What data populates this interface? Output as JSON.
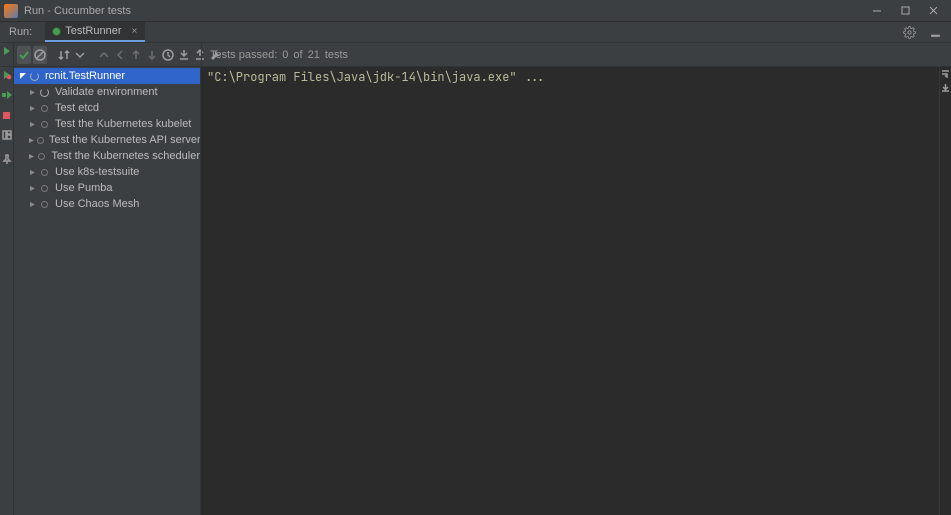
{
  "window": {
    "title": "Run - Cucumber tests"
  },
  "run_tab": {
    "label": "Run:",
    "active_tab": "TestRunner"
  },
  "status": {
    "prefix": "Tests passed:",
    "passed": "0",
    "separator": "of",
    "total": "21",
    "suffix": "tests"
  },
  "tree": {
    "root": "rcnit.TestRunner",
    "items": [
      {
        "label": "Validate environment",
        "running": true
      },
      {
        "label": "Test etcd",
        "running": false
      },
      {
        "label": "Test the Kubernetes kubelet",
        "running": false
      },
      {
        "label": "Test the Kubernetes API server",
        "running": false
      },
      {
        "label": "Test the Kubernetes scheduler",
        "running": false
      },
      {
        "label": "Use k8s-testsuite",
        "running": false
      },
      {
        "label": "Use Pumba",
        "running": false
      },
      {
        "label": "Use Chaos Mesh",
        "running": false
      }
    ]
  },
  "console": {
    "line1": "\"C:\\Program Files\\Java\\jdk-14\\bin\\java.exe\" ..."
  },
  "colors": {
    "accent_blue": "#2f65ca",
    "green": "#499c54",
    "background_dark": "#2b2b2b",
    "panel": "#3c3f41"
  },
  "icons": {
    "minimize": "—",
    "maximize": "▢",
    "close": "✕",
    "gear": "gear",
    "hide": "hide"
  }
}
